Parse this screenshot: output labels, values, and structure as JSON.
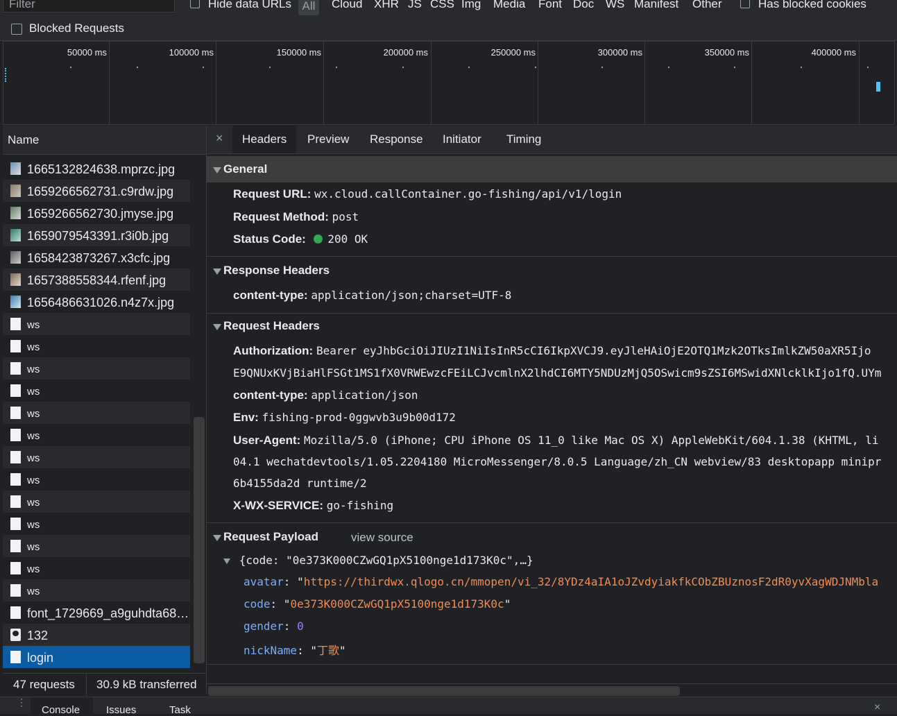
{
  "filterbar": {
    "filter_placeholder": "Filter",
    "hide_data_urls": "Hide data URLs",
    "all": "All",
    "types": [
      "Cloud",
      "XHR",
      "JS",
      "CSS",
      "Img",
      "Media",
      "Font",
      "Doc",
      "WS",
      "Manifest",
      "Other"
    ],
    "has_blocked_cookies": "Has blocked cookies",
    "blocked_requests": "Blocked Requests"
  },
  "overview": {
    "labels": [
      "50000 ms",
      "100000 ms",
      "150000 ms",
      "200000 ms",
      "250000 ms",
      "300000 ms",
      "350000 ms",
      "400000 ms"
    ]
  },
  "requests": {
    "header": "Name",
    "items": [
      {
        "name": "1665132824638.mprzc.jpg",
        "kind": "image"
      },
      {
        "name": "1659266562731.c9rdw.jpg",
        "kind": "image"
      },
      {
        "name": "1659266562730.jmyse.jpg",
        "kind": "image"
      },
      {
        "name": "1659079543391.r3i0b.jpg",
        "kind": "image"
      },
      {
        "name": "1658423873267.x3cfc.jpg",
        "kind": "image"
      },
      {
        "name": "1657388558344.rfenf.jpg",
        "kind": "image"
      },
      {
        "name": "1656486631026.n4z7x.jpg",
        "kind": "image"
      },
      {
        "name": "ws",
        "kind": "ws"
      },
      {
        "name": "ws",
        "kind": "ws"
      },
      {
        "name": "ws",
        "kind": "ws"
      },
      {
        "name": "ws",
        "kind": "ws"
      },
      {
        "name": "ws",
        "kind": "ws"
      },
      {
        "name": "ws",
        "kind": "ws"
      },
      {
        "name": "ws",
        "kind": "ws"
      },
      {
        "name": "ws",
        "kind": "ws"
      },
      {
        "name": "ws",
        "kind": "ws"
      },
      {
        "name": "ws",
        "kind": "ws"
      },
      {
        "name": "ws",
        "kind": "ws"
      },
      {
        "name": "ws",
        "kind": "ws"
      },
      {
        "name": "ws",
        "kind": "ws"
      },
      {
        "name": "font_1729669_a9guhdta68q....",
        "kind": "doc"
      },
      {
        "name": "132",
        "kind": "avatar"
      },
      {
        "name": "login",
        "kind": "doc",
        "selected": true
      }
    ],
    "summary_count": "47 requests",
    "summary_transferred": "30.9 kB transferred"
  },
  "detail_tabs": [
    "Headers",
    "Preview",
    "Response",
    "Initiator",
    "Timing"
  ],
  "general": {
    "title": "General",
    "request_url_label": "Request URL:",
    "request_url": "wx.cloud.callContainer.go-fishing/api/v1/login",
    "request_method_label": "Request Method:",
    "request_method": "post",
    "status_code_label": "Status Code:",
    "status_code": "200 OK",
    "status_color": "#34a853"
  },
  "response_headers": {
    "title": "Response Headers",
    "content_type_label": "content-type:",
    "content_type": "application/json;charset=UTF-8"
  },
  "request_headers": {
    "title": "Request Headers",
    "authorization_label": "Authorization:",
    "authorization_line1": "Bearer eyJhbGciOiJIUzI1NiIsInR5cCI6IkpXVCJ9.eyJleHAiOjE2OTQ1Mzk2OTksImlkZW50aXR5Ijo",
    "authorization_line2": "E9QNUxKVjBiaHlFSGt1MS1fX0VRWEwzcFEiLCJvcmlnX2lhdCI6MTY5NDUzMjQ5OSwicm9sZSI6MSwidXNlcklkIjo1fQ.UYm",
    "content_type_label": "content-type:",
    "content_type": "application/json",
    "env_label": "Env:",
    "env": "fishing-prod-0ggwvb3u9b00d172",
    "user_agent_label": "User-Agent:",
    "user_agent_line1": "Mozilla/5.0 (iPhone; CPU iPhone OS 11_0 like Mac OS X) AppleWebKit/604.1.38 (KHTML, li",
    "user_agent_line2": "04.1 wechatdevtools/1.05.2204180 MicroMessenger/8.0.5 Language/zh_CN webview/83 desktopapp minipr",
    "user_agent_line3": "6b4155da2d runtime/2",
    "xwx_label": "X-WX-SERVICE:",
    "xwx": "go-fishing"
  },
  "payload": {
    "title": "Request Payload",
    "view_source": "view source",
    "summary": "{code: \"0e373K000CZwGQ1pX5100nge1d173K0c\",…}",
    "fields": [
      {
        "key": "avatar",
        "value": "https://thirdwx.qlogo.cn/mmopen/vi_32/8YDz4aIA1oJZvdyiakfkCObZBUznosF2dR0yvXagWDJNMbla",
        "type": "string"
      },
      {
        "key": "code",
        "value": "0e373K000CZwGQ1pX5100nge1d173K0c",
        "type": "string"
      },
      {
        "key": "gender",
        "value": "0",
        "type": "number"
      },
      {
        "key": "nickName",
        "value": "丁歌",
        "type": "string"
      }
    ]
  },
  "drawer": {
    "tabs": [
      "Console",
      "Issues",
      "Task"
    ]
  }
}
